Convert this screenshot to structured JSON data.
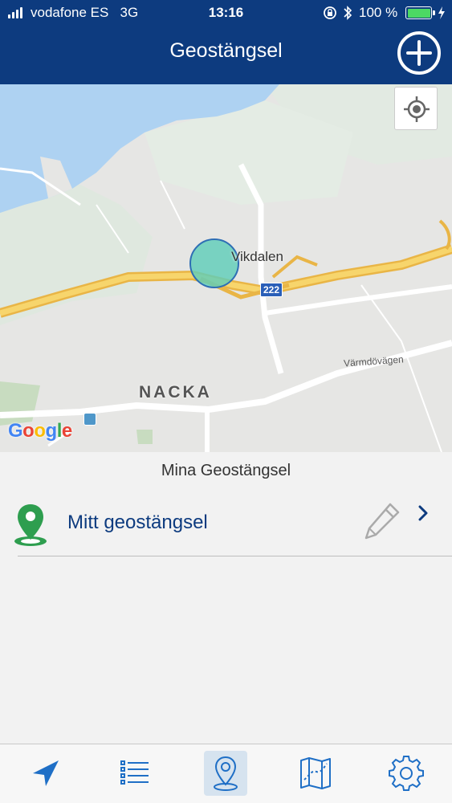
{
  "status_bar": {
    "carrier": "vodafone ES",
    "network": "3G",
    "time": "13:16",
    "battery": "100 %",
    "battery_level": 1.0,
    "icons": [
      "signal-icon",
      "rotation-lock-icon",
      "bluetooth-icon",
      "battery-icon",
      "charging-icon"
    ]
  },
  "nav": {
    "title": "Geostängsel",
    "add_icon": "plus-circle-icon"
  },
  "map": {
    "place_label": "Vikdalen",
    "road_label": "Värmdövägen",
    "district_label": "NACKA",
    "route_shield": "222",
    "logo": [
      "G",
      "o",
      "o",
      "g",
      "l",
      "e"
    ],
    "logo_colors": [
      "#4285f4",
      "#ea4335",
      "#fbbc05",
      "#4285f4",
      "#34a853",
      "#ea4335"
    ],
    "locate_icon": "my-location-icon",
    "geofence_color": "#5fcdb9"
  },
  "list": {
    "header": "Mina Geostängsel",
    "items": [
      {
        "name": "Mitt geostängsel",
        "icon": "map-pin-icon",
        "edit_icon": "pencil-icon",
        "chevron_icon": "chevron-right-icon"
      }
    ]
  },
  "tabs": [
    {
      "icon": "navigation-arrow-icon",
      "active": false
    },
    {
      "icon": "list-icon",
      "active": false
    },
    {
      "icon": "map-pin-outline-icon",
      "active": true
    },
    {
      "icon": "map-route-icon",
      "active": false
    },
    {
      "icon": "gear-icon",
      "active": false
    }
  ],
  "colors": {
    "primary": "#0d3b7f",
    "pin_green": "#2e9e4f",
    "tab_blue": "#1f6fc6"
  }
}
